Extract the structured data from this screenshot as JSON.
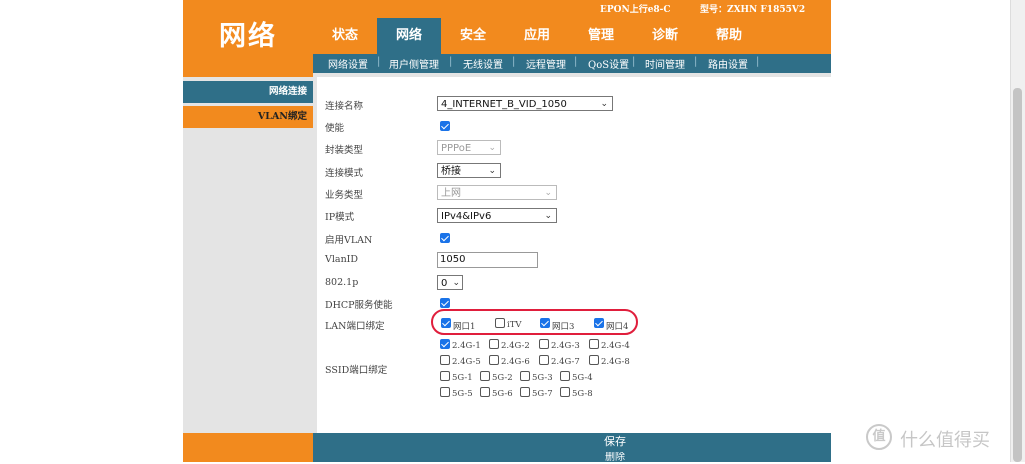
{
  "header": {
    "logo": "网络",
    "product": "EPON上行e8-C",
    "model": "型号：ZXHN F1855V2"
  },
  "nav": {
    "tabs": [
      {
        "label": "状态"
      },
      {
        "label": "网络",
        "active": true
      },
      {
        "label": "安全"
      },
      {
        "label": "应用"
      },
      {
        "label": "管理"
      },
      {
        "label": "诊断"
      },
      {
        "label": "帮助"
      }
    ],
    "subtabs": [
      "网络设置",
      "用户侧管理",
      "无线设置",
      "远程管理",
      "QoS设置",
      "时间管理",
      "路由设置"
    ]
  },
  "sidebar": {
    "items": [
      {
        "label": "网络连接"
      },
      {
        "label": "VLAN绑定"
      }
    ]
  },
  "form": {
    "conn_name_label": "连接名称",
    "conn_name_value": "4_INTERNET_B_VID_1050",
    "enable_label": "使能",
    "encap_label": "封装类型",
    "encap_value": "PPPoE",
    "mode_label": "连接模式",
    "mode_value": "桥接",
    "service_label": "业务类型",
    "service_value": "上网",
    "ipmode_label": "IP模式",
    "ipmode_value": "IPv4&IPv6",
    "vlan_enable_label": "启用VLAN",
    "vlanid_label": "VlanID",
    "vlanid_value": "1050",
    "dot1p_label": "802.1p",
    "dot1p_value": "0",
    "dhcp_label": "DHCP服务使能",
    "lan_bind_label": "LAN端口绑定",
    "lan_ports": [
      {
        "label": "网口1",
        "checked": true
      },
      {
        "label": "iTV",
        "checked": false
      },
      {
        "label": "网口3",
        "checked": true
      },
      {
        "label": "网口4",
        "checked": true
      }
    ],
    "ssid_bind_label": "SSID端口绑定",
    "ssids": [
      {
        "label": "2.4G-1",
        "checked": true
      },
      {
        "label": "2.4G-2",
        "checked": false
      },
      {
        "label": "2.4G-3",
        "checked": false
      },
      {
        "label": "2.4G-4",
        "checked": false
      },
      {
        "label": "2.4G-5",
        "checked": false
      },
      {
        "label": "2.4G-6",
        "checked": false
      },
      {
        "label": "2.4G-7",
        "checked": false
      },
      {
        "label": "2.4G-8",
        "checked": false
      },
      {
        "label": "5G-1",
        "checked": false
      },
      {
        "label": "5G-2",
        "checked": false
      },
      {
        "label": "5G-3",
        "checked": false
      },
      {
        "label": "5G-4",
        "checked": false
      },
      {
        "label": "5G-5",
        "checked": false
      },
      {
        "label": "5G-6",
        "checked": false
      },
      {
        "label": "5G-7",
        "checked": false
      },
      {
        "label": "5G-8",
        "checked": false
      }
    ]
  },
  "footer": {
    "save_label": "保存",
    "delete_label": "删除"
  },
  "watermark": {
    "icon": "值",
    "text": "什么值得买"
  },
  "colors": {
    "orange": "#f28a1e",
    "teal": "#2f6f88",
    "checkbox": "#1a73e8",
    "highlight": "#e01e3c"
  }
}
